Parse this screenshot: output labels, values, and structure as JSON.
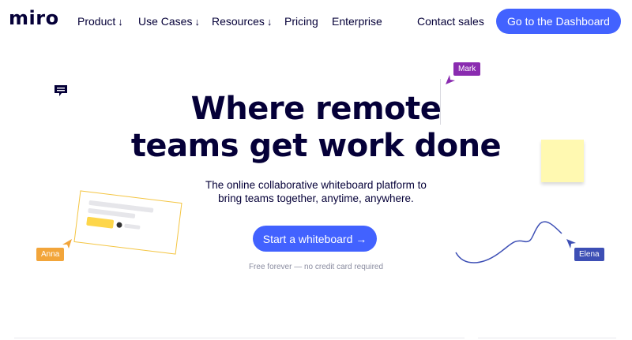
{
  "nav": {
    "logo": "miro",
    "items": [
      {
        "label": "Product",
        "arrow": "↓"
      },
      {
        "label": "Use Cases",
        "arrow": "↓"
      },
      {
        "label": "Resources",
        "arrow": "↓"
      },
      {
        "label": "Pricing",
        "arrow": ""
      },
      {
        "label": "Enterprise",
        "arrow": ""
      }
    ],
    "contact": "Contact sales",
    "dashboard": "Go to the Dashboard"
  },
  "hero": {
    "title_line1": "Where remote",
    "title_line2": "teams get work done",
    "subtitle_line1": "The online collaborative whiteboard platform to",
    "subtitle_line2": "bring teams together, anytime, anywhere.",
    "cta": "Start a whiteboard →",
    "note": "Free forever — no credit card required"
  },
  "collaborators": {
    "mark": "Mark",
    "anna": "Anna",
    "elena": "Elena"
  },
  "colors": {
    "brand_blue": "#4262ff",
    "text_dark": "#050038",
    "mark": "#8a2bb0",
    "anna": "#f2a53a",
    "elena": "#3d4fb5",
    "sticky": "#fff9b1"
  },
  "icons": {
    "chat": "chat-bubble-icon",
    "cursor": "pointer-cursor-icon"
  }
}
